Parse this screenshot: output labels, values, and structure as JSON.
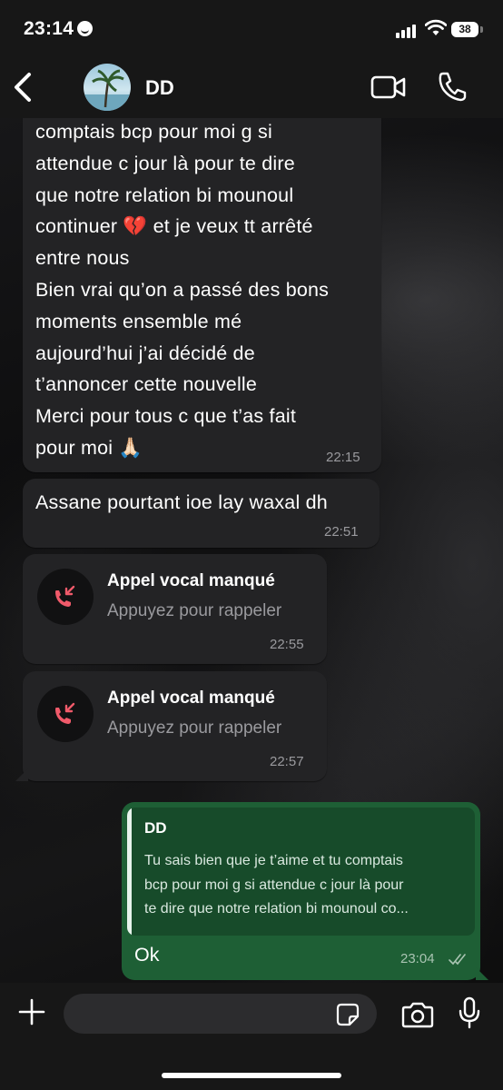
{
  "status_bar": {
    "time": "23:14",
    "battery": "38"
  },
  "header": {
    "contact_name": "DD"
  },
  "messages": [
    {
      "lines": [
        "comptais bcp pour moi g si",
        "attendue c jour là pour te dire",
        "que notre relation bi mounoul",
        "continuer 💔 et je veux tt arrêté",
        "entre nous",
        "Bien vrai qu’on a passé des bons",
        "moments ensemble mé",
        "aujourd’hui j’ai décidé de",
        "t’annoncer cette nouvelle",
        "Merci pour tous c que t’as fait",
        "pour moi 🙏🏻"
      ],
      "time": "22:15"
    },
    {
      "text": "Assane pourtant ioe lay waxal dh",
      "time": "22:51"
    }
  ],
  "calls": [
    {
      "title": "Appel vocal manqué",
      "subtitle": "Appuyez pour rappeler",
      "time": "22:55"
    },
    {
      "title": "Appel vocal manqué",
      "subtitle": "Appuyez pour rappeler",
      "time": "22:57"
    }
  ],
  "reply": {
    "quoted_name": "DD",
    "quoted_text": "Tu sais bien que je t’aime et tu comptais\nbcp pour moi g si attendue c jour là pour\nte dire que notre relation bi mounoul co...",
    "text": "Ok",
    "time": "23:04"
  },
  "composer": {
    "placeholder": ""
  },
  "colors": {
    "outgoing_bubble": "#1e5f35",
    "incoming_bubble": "#232325",
    "missed_call": "#f05a6a"
  }
}
